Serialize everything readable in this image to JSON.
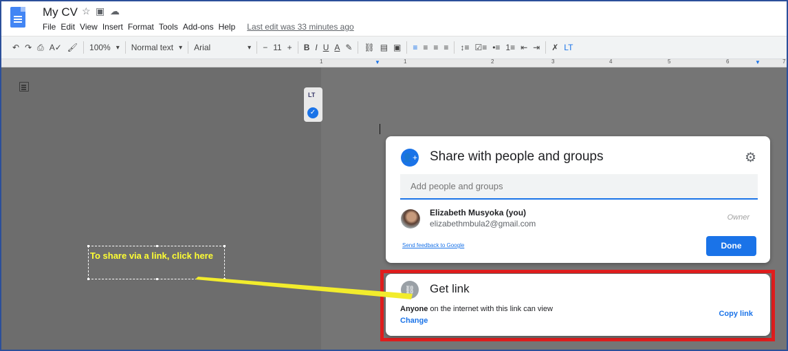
{
  "header": {
    "doc_title": "My CV",
    "title_icons": [
      "star-icon",
      "folder-icon",
      "cloud-icon"
    ],
    "menu": [
      "File",
      "Edit",
      "View",
      "Insert",
      "Format",
      "Tools",
      "Add-ons",
      "Help"
    ],
    "last_edit": "Last edit was 33 minutes ago"
  },
  "toolbar": {
    "zoom": "100%",
    "style": "Normal text",
    "font": "Arial",
    "font_size": "11",
    "minus": "−",
    "plus": "+"
  },
  "ruler": [
    "1",
    "1",
    "2",
    "3",
    "4",
    "5",
    "6",
    "7"
  ],
  "widget": {
    "logo": "LT"
  },
  "share_panel": {
    "title": "Share with people and groups",
    "add_placeholder": "Add people and groups",
    "user_name": "Elizabeth Musyoka (you)",
    "user_email": "elizabethmbula2@gmail.com",
    "role": "Owner",
    "feedback": "Send feedback to Google",
    "done": "Done"
  },
  "get_link": {
    "title": "Get link",
    "desc_bold": "Anyone",
    "desc_rest": " on the internet with this link can view",
    "change": "Change",
    "copy": "Copy link"
  },
  "annotation": {
    "text": "To share via a link, click here"
  },
  "colors": {
    "accent": "#1a73e8",
    "highlight_box": "#e01d1d",
    "annotation_text": "#ffff33"
  }
}
